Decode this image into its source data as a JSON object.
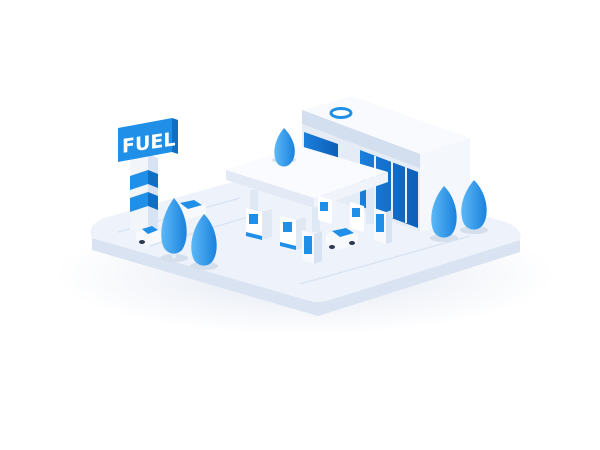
{
  "scene": {
    "sign_text": "FUEL"
  },
  "colors": {
    "background": "#ffffff",
    "base_top": "#eef3fb",
    "base_side": "#dde6f3",
    "accent_blue": "#1f8fe8",
    "accent_light": "#55b4f6",
    "accent_dark": "#0f6fc4",
    "white_face": "#f7f9fd",
    "shade_face": "#d7e2f2",
    "glass": "#1877d6"
  }
}
